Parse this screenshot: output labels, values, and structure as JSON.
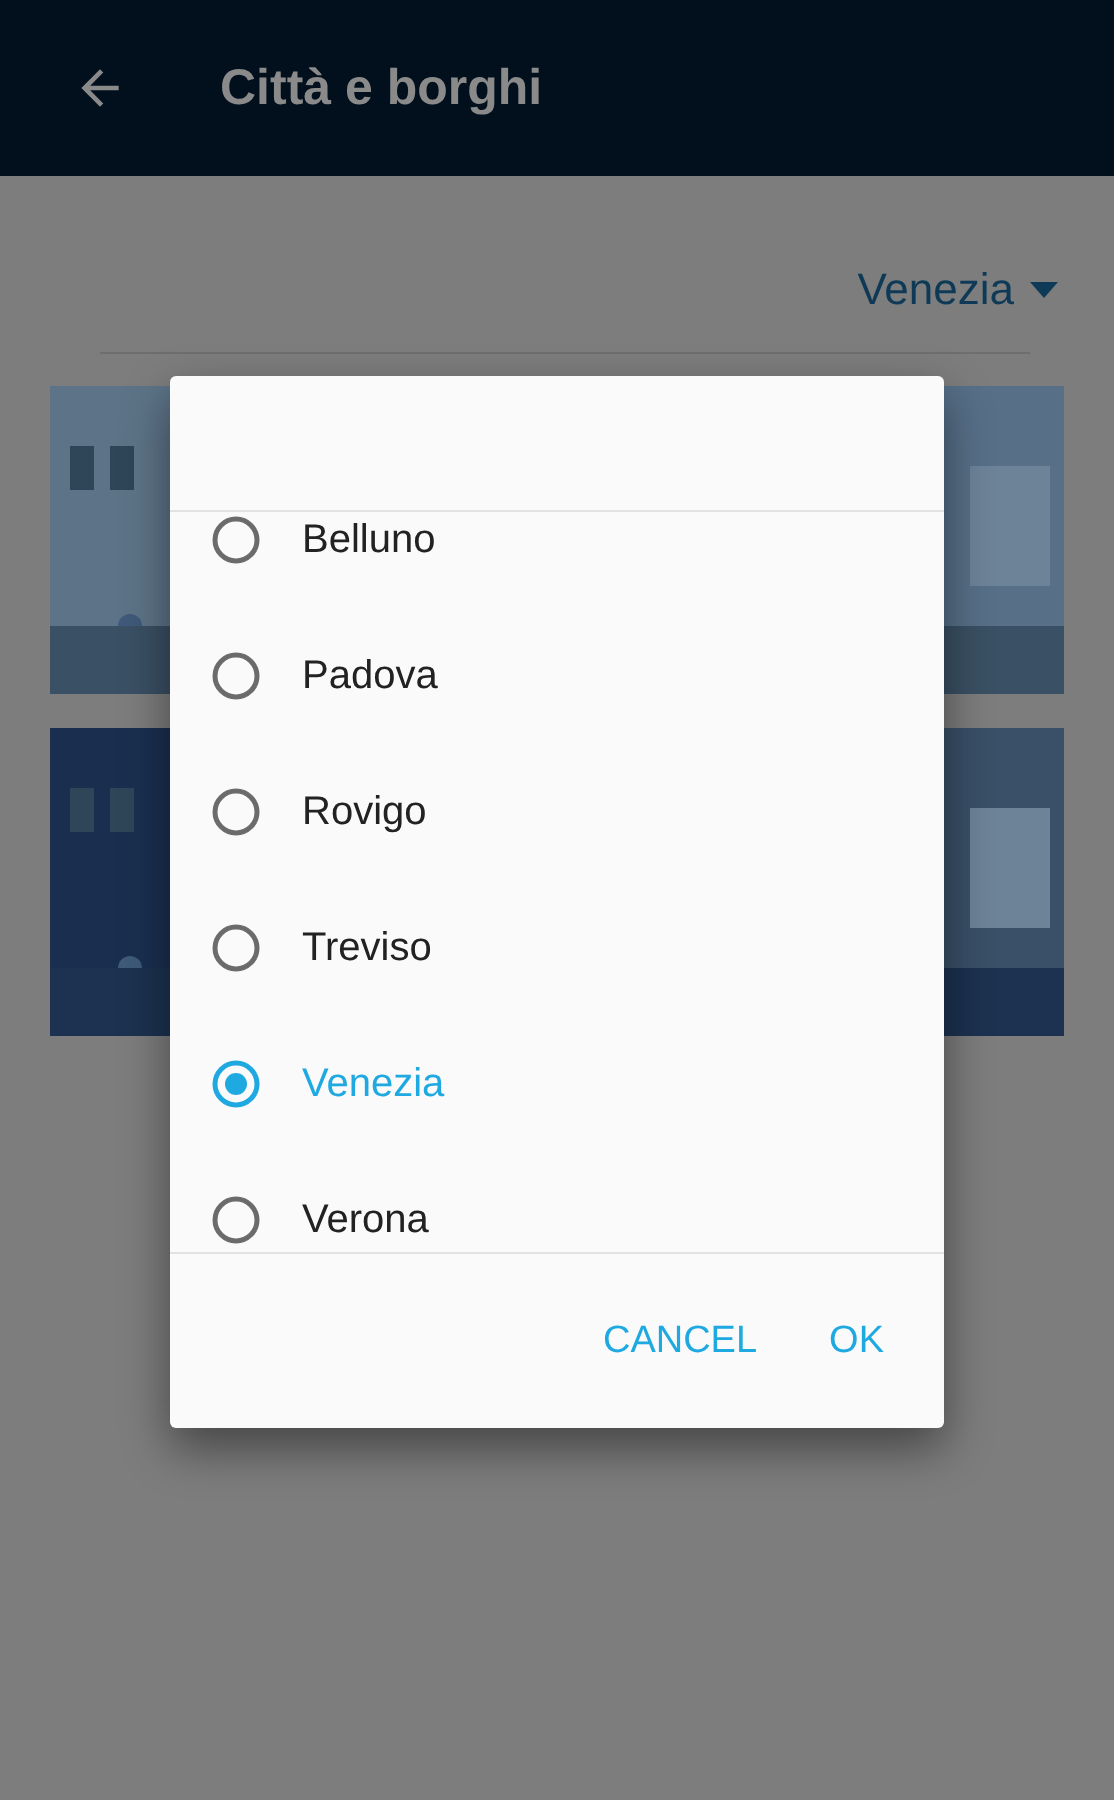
{
  "app_bar": {
    "title": "Città e borghi"
  },
  "region_select": {
    "value": "Venezia"
  },
  "dialog": {
    "options": [
      {
        "label": "Belluno",
        "selected": false
      },
      {
        "label": "Padova",
        "selected": false
      },
      {
        "label": "Rovigo",
        "selected": false
      },
      {
        "label": "Treviso",
        "selected": false
      },
      {
        "label": "Venezia",
        "selected": true
      },
      {
        "label": "Verona",
        "selected": false
      }
    ],
    "buttons": [
      "CANCEL",
      "OK"
    ]
  }
}
